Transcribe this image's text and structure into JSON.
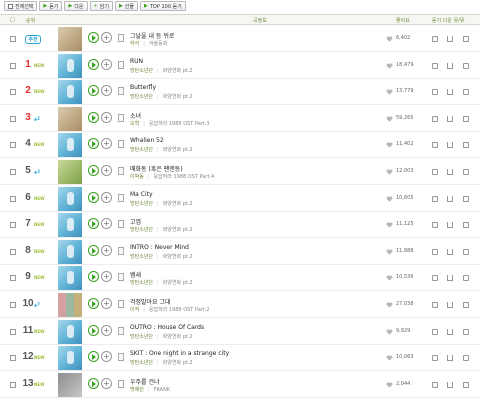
{
  "toolbar": {
    "select_all": "전체선택",
    "listen": "듣기",
    "download": "다운",
    "add": "담기",
    "gift": "선물",
    "top100": "TOP 100 듣기"
  },
  "header": {
    "rank": "순위",
    "song_info": "곡정보",
    "likes": "좋아요",
    "actions": "듣기 다운 뮤/뮤"
  },
  "colors": {
    "accent": "#39a022",
    "rank_top": "#e32b2b",
    "artist": "#6f8a3e"
  },
  "songs": [
    {
      "rank": "",
      "rank_label": "추천",
      "change": "",
      "title": "그날을 내 등 뒤로",
      "artist": "하각",
      "album": "겨울동화",
      "likes": "6,402",
      "thumb": "warm"
    },
    {
      "rank": "1",
      "change": "NEW",
      "title": "RUN",
      "artist": "방탄소년단",
      "album": "화양연화 pt.2",
      "likes": "18,479",
      "thumb": "blue"
    },
    {
      "rank": "2",
      "change": "NEW",
      "title": "Butterfly",
      "artist": "방탄소년단",
      "album": "화양연화 pt.2",
      "likes": "13,779",
      "thumb": "blue"
    },
    {
      "rank": "3",
      "change": "▲2",
      "title": "소녀",
      "artist": "오혁",
      "album": "응답하라 1988 OST Part.3",
      "likes": "59,265",
      "thumb": "warm"
    },
    {
      "rank": "4",
      "change": "NEW",
      "title": "Whalien 52",
      "artist": "방탄소년단",
      "album": "화양연화 pt.2",
      "likes": "11,402",
      "thumb": "blue"
    },
    {
      "rank": "5",
      "change": "▲3",
      "title": "매화동 (혹은 팬앤동)",
      "artist": "이박동",
      "album": "응답하라 1988 OST Part.4",
      "likes": "12,003",
      "thumb": "green"
    },
    {
      "rank": "6",
      "change": "NEW",
      "title": "Ma City",
      "artist": "방탄소년단",
      "album": "화양연화 pt.2",
      "likes": "10,605",
      "thumb": "blue"
    },
    {
      "rank": "7",
      "change": "NEW",
      "title": "고엽",
      "artist": "방탄소년단",
      "album": "화양연화 pt.2",
      "likes": "11,125",
      "thumb": "blue"
    },
    {
      "rank": "8",
      "change": "NEW",
      "title": "INTRO : Never Mind",
      "artist": "방탄소년단",
      "album": "화양연화 pt.2",
      "likes": "11,888",
      "thumb": "blue"
    },
    {
      "rank": "9",
      "change": "NEW",
      "title": "뱁새",
      "artist": "방탄소년단",
      "album": "화양연화 pt.2",
      "likes": "10,536",
      "thumb": "blue"
    },
    {
      "rank": "10",
      "change": "▲7",
      "title": "걱정말아요 그대",
      "artist": "이적",
      "album": "응답하라 1988 OST Part.2",
      "likes": "27,038",
      "thumb": "grid"
    },
    {
      "rank": "11",
      "change": "NEW",
      "title": "OUTRO : House Of Cards",
      "artist": "방탄소년단",
      "album": "화양연화 pt.2",
      "likes": "9,929",
      "thumb": "blue"
    },
    {
      "rank": "12",
      "change": "NEW",
      "title": "SKIT : One night in a strange city",
      "artist": "방탄소년단",
      "album": "화양연화 pt.2",
      "likes": "10,063",
      "thumb": "blue"
    },
    {
      "rank": "13",
      "change": "NEW",
      "title": "우주를 건너",
      "artist": "백예린",
      "album": "FRANK",
      "likes": "2,044",
      "thumb": "gray"
    }
  ]
}
